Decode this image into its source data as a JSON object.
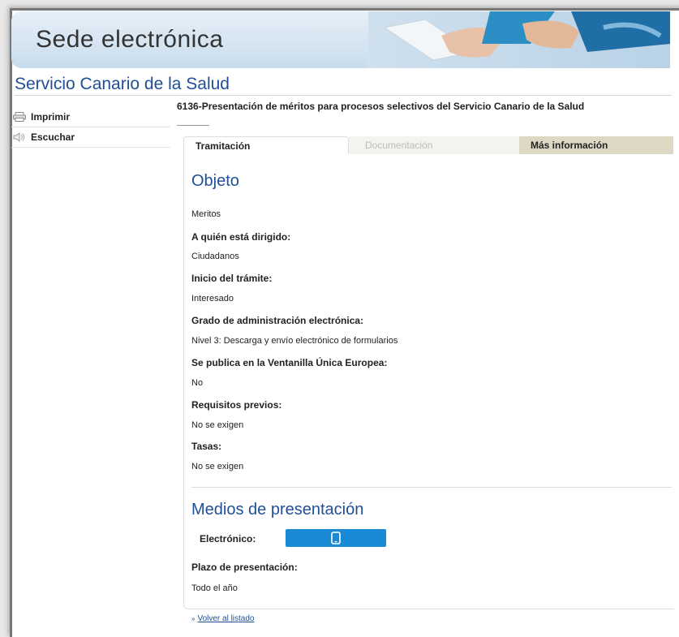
{
  "banner": {
    "title": "Sede electrónica"
  },
  "section_title": "Servicio Canario de la Salud",
  "left_menu": [
    {
      "label": "Imprimir",
      "icon": "printer-icon"
    },
    {
      "label": "Escuchar",
      "icon": "speaker-icon"
    }
  ],
  "procedure_title": "6136-Presentación de méritos para procesos selectivos del Servicio Canario de la Salud",
  "tabs": [
    {
      "label": "Tramitación",
      "state": "active"
    },
    {
      "label": "Documentación",
      "state": "disabled"
    },
    {
      "label": "Más información",
      "state": "normal"
    }
  ],
  "objeto": {
    "heading": "Objeto",
    "description": "Meritos",
    "fields": [
      {
        "label": "A quién está dirigido:",
        "value": "Ciudadanos"
      },
      {
        "label": "Inicio del trámite:",
        "value": "Interesado"
      },
      {
        "label": "Grado de administración electrónica:",
        "value": "Nivel 3: Descarga y envío electrónico de formularios"
      },
      {
        "label": "Se publica en la Ventanilla Única Europea:",
        "value": "No"
      },
      {
        "label": "Requisitos previos:",
        "value": "No se exigen"
      },
      {
        "label": "Tasas:",
        "value": "No se exigen"
      }
    ]
  },
  "medios": {
    "heading": "Medios de presentación",
    "electronic_label": "Electrónico:",
    "electronic_icon": "mobile-device-icon",
    "plazo_label": "Plazo de presentación:",
    "plazo_value": "Todo el año"
  },
  "back_link": "Volver al listado",
  "colors": {
    "accent": "#1f4f96",
    "button": "#1a8ad6",
    "tab_more": "#ddd8c4"
  }
}
